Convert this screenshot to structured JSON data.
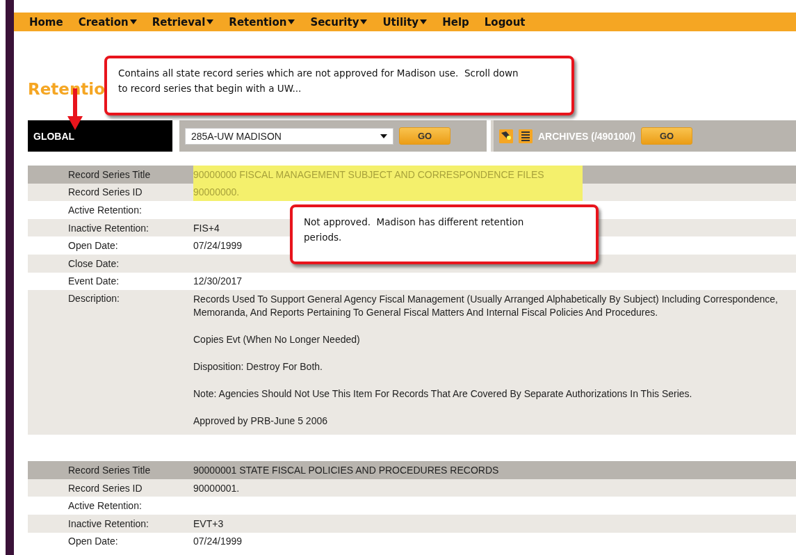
{
  "nav": [
    {
      "label": "Home",
      "dropdown": false
    },
    {
      "label": "Creation",
      "dropdown": true
    },
    {
      "label": "Retrieval",
      "dropdown": true
    },
    {
      "label": "Retention",
      "dropdown": true
    },
    {
      "label": "Security",
      "dropdown": true
    },
    {
      "label": "Utility",
      "dropdown": true
    },
    {
      "label": "Help",
      "dropdown": false
    },
    {
      "label": "Logout",
      "dropdown": false
    }
  ],
  "heading": "Retentio",
  "callouts": [
    {
      "text": "Contains all state record series which are not approved for Madison use.  Scroll down to record series that begin with a UW..."
    },
    {
      "text": "Not approved.  Madison has different retention periods."
    }
  ],
  "scope": {
    "label": "GLOBAL",
    "select_value": "285A-UW MADISON",
    "go": "GO",
    "archives": "ARCHIVES (/490100/)",
    "archives_go": "GO"
  },
  "records": [
    {
      "rows": [
        {
          "kind": "title",
          "label": "Record Series Title",
          "value": "90000000 FISCAL MANAGEMENT SUBJECT AND CORRESPONDENCE FILES",
          "highlighted": true
        },
        {
          "kind": "field",
          "label": "Record Series ID",
          "value": "90000000.",
          "highlighted": true
        },
        {
          "kind": "field",
          "label": "Active Retention:",
          "value": "",
          "highlighted": false
        },
        {
          "kind": "field",
          "label": "Inactive Retention:",
          "value": "FIS+4",
          "highlighted": false
        },
        {
          "kind": "field",
          "label": "Open Date:",
          "value": "07/24/1999",
          "highlighted": false
        },
        {
          "kind": "field",
          "label": "Close Date:",
          "value": "",
          "highlighted": false
        },
        {
          "kind": "field",
          "label": "Event Date:",
          "value": "12/30/2017",
          "highlighted": false
        },
        {
          "kind": "description",
          "label": "Description:",
          "paragraphs": [
            "Records Used To Support General Agency Fiscal Management (Usually Arranged Alphabetically By Subject) Including Correspondence, Memoranda, And Reports Pertaining To General Fiscal Matters And Internal Fiscal Policies And Procedures.",
            "Copies Evt (When No Longer Needed)",
            "Disposition: Destroy For Both.",
            "Note: Agencies Should Not Use This Item For Records That Are Covered By Separate Authorizations In This Series.",
            "Approved by PRB-June 5 2006"
          ]
        }
      ]
    },
    {
      "rows": [
        {
          "kind": "title",
          "label": "Record Series Title",
          "value": "90000001 STATE FISCAL POLICIES AND PROCEDURES RECORDS",
          "highlighted": false
        },
        {
          "kind": "field",
          "label": "Record Series ID",
          "value": "90000001.",
          "highlighted": false
        },
        {
          "kind": "field",
          "label": "Active Retention:",
          "value": "",
          "highlighted": false
        },
        {
          "kind": "field",
          "label": "Inactive Retention:",
          "value": "EVT+3",
          "highlighted": false
        },
        {
          "kind": "field",
          "label": "Open Date:",
          "value": "07/24/1999",
          "highlighted": false
        }
      ]
    }
  ]
}
